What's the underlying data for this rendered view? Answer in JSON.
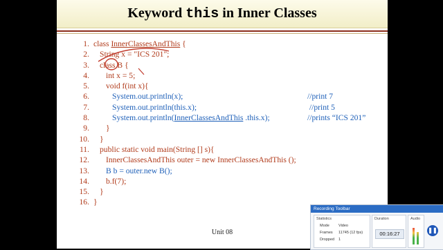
{
  "slide": {
    "title_pre": "Keyword ",
    "title_kw": "this",
    "title_post": " in Inner Classes",
    "footer": "Unit 08",
    "lines": [
      {
        "n": "1.",
        "parts": [
          {
            "t": "class ",
            "c": "red"
          },
          {
            "t": "InnerClassesAndThis",
            "c": "red",
            "u": true
          },
          {
            "t": " {",
            "c": "red"
          }
        ],
        "indent": 0
      },
      {
        "n": "2.",
        "parts": [
          {
            "t": "String x = \"ICS 201\";",
            "c": "red"
          }
        ],
        "indent": 1
      },
      {
        "n": "3.",
        "parts": [
          {
            "t": "class B {",
            "c": "red"
          }
        ],
        "indent": 1
      },
      {
        "n": "4.",
        "parts": [
          {
            "t": "int x = 5;",
            "c": "red"
          }
        ],
        "indent": 2
      },
      {
        "n": "5.",
        "parts": [
          {
            "t": "void f(int x){",
            "c": "red"
          }
        ],
        "indent": 2
      },
      {
        "n": "6.",
        "parts": [
          {
            "t": "System.out.println(x);",
            "c": "blue"
          }
        ],
        "indent": 3,
        "comment": "//print 7"
      },
      {
        "n": "7.",
        "parts": [
          {
            "t": "System.out.println(this.x);",
            "c": "blue"
          }
        ],
        "indent": 3,
        "comment": " //print 5"
      },
      {
        "n": "8.",
        "parts": [
          {
            "t": "System.out.println(",
            "c": "blue"
          },
          {
            "t": "InnerClassesAndThis",
            "c": "blue",
            "u": true
          },
          {
            "t": " .this.x);",
            "c": "blue"
          }
        ],
        "indent": 3,
        "comment": "//prints “ICS 201”"
      },
      {
        "n": "9.",
        "parts": [
          {
            "t": "}",
            "c": "red"
          }
        ],
        "indent": 2
      },
      {
        "n": "10.",
        "parts": [
          {
            "t": "}",
            "c": "red"
          }
        ],
        "indent": 1
      },
      {
        "n": "11.",
        "parts": [
          {
            "t": "public static void main(String [] s){",
            "c": "red"
          }
        ],
        "indent": 1
      },
      {
        "n": "12.",
        "parts": [
          {
            "t": "InnerClassesAndThis outer = new InnerClassesAndThis ();",
            "c": "red"
          }
        ],
        "indent": 2
      },
      {
        "n": "13.",
        "parts": [
          {
            "t": "B b = outer.new B();",
            "c": "blue"
          }
        ],
        "indent": 2
      },
      {
        "n": "14.",
        "parts": [
          {
            "t": "b.f(7);",
            "c": "red"
          }
        ],
        "indent": 2
      },
      {
        "n": "15.",
        "parts": [
          {
            "t": "}",
            "c": "red"
          }
        ],
        "indent": 1
      },
      {
        "n": "16.",
        "parts": [
          {
            "t": "}",
            "c": "red"
          }
        ],
        "indent": 0
      }
    ]
  },
  "recorder": {
    "title": "Recording Toolbar",
    "statistics_label": "Statistics",
    "duration_label": "Duration",
    "audio_label": "Audio",
    "mode_label": "Mode",
    "mode_value": "Video",
    "frames_label": "Frames",
    "frames_value": "11745 (12 fps)",
    "dropped_label": "Dropped",
    "dropped_value": "1",
    "duration_value": "00:16:27",
    "pause_icon": "pause-icon"
  },
  "colors": {
    "code_red": "#b03a1a",
    "code_blue": "#1d5fb8",
    "ink": "#c0392b",
    "toolbar_blue": "#2b6cc4"
  }
}
